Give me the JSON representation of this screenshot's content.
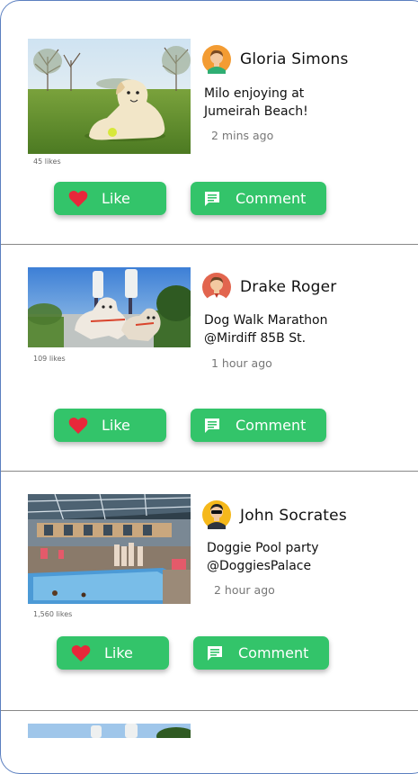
{
  "posts": [
    {
      "author": "Gloria Simons",
      "caption_line1": "Milo enjoying at",
      "caption_line2": "Jumeirah Beach!",
      "time": "2 mins ago",
      "likes": "45 likes",
      "like_label": "Like",
      "comment_label": "Comment"
    },
    {
      "author": "Drake Roger",
      "caption_line1": "Dog Walk Marathon",
      "caption_line2": "@Mirdiff 85B St.",
      "time": "1 hour ago",
      "likes": "109 likes",
      "like_label": "Like",
      "comment_label": "Comment"
    },
    {
      "author": "John Socrates",
      "caption_line1": "Doggie Pool party",
      "caption_line2": "@DoggiesPalace",
      "time": "2 hour ago",
      "likes": "1,560 likes",
      "like_label": "Like",
      "comment_label": "Comment"
    }
  ],
  "icons": {
    "like": "heart-icon",
    "comment": "comment-icon"
  },
  "colors": {
    "button": "#33c46a",
    "heart": "#e8283a",
    "divider": "#888888"
  }
}
